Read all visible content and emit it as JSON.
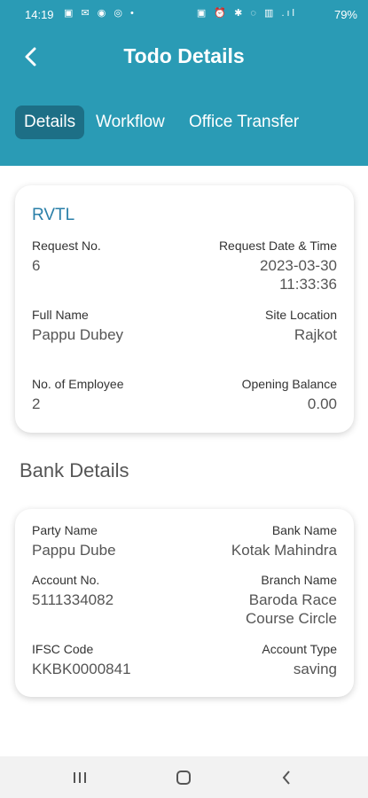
{
  "status_bar": {
    "time": "14:19",
    "left_icons": "▣ ✉ ◉ ◎ •",
    "right_icons": "▣ ⏰ ✱ ◌ ▥ .ıl",
    "battery": "79%"
  },
  "header": {
    "title": "Todo Details",
    "back_icon": "chevron-left-icon",
    "background_color": "#2a9bb5"
  },
  "tabs": [
    {
      "label": "Details",
      "active": true
    },
    {
      "label": "Workflow",
      "active": false
    },
    {
      "label": "Office Transfer",
      "active": false
    }
  ],
  "request_card": {
    "heading": "RVTL",
    "request_no_label": "Request No.",
    "request_no": "6",
    "request_date_label": "Request Date & Time",
    "request_date": "2023-03-30",
    "request_time": "11:33:36",
    "full_name_label": "Full Name",
    "full_name": "Pappu Dubey",
    "site_location_label": "Site Location",
    "site_location": "Rajkot",
    "employees_label": "No. of Employee",
    "employees": "2",
    "opening_balance_label": "Opening Balance",
    "opening_balance": "0.00"
  },
  "bank_section_title": "Bank Details",
  "bank_card": {
    "party_name_label": "Party Name",
    "party_name": "Pappu Dube",
    "bank_name_label": "Bank Name",
    "bank_name": "Kotak Mahindra",
    "account_no_label": "Account No.",
    "account_no": "5111334082",
    "branch_name_label": "Branch Name",
    "branch_line1": "Baroda Race",
    "branch_line2": "Course Circle",
    "ifsc_label": "IFSC Code",
    "ifsc": "KKBK0000841",
    "account_type_label": "Account Type",
    "account_type": "saving"
  },
  "nav_bar": {
    "recents_icon": "recents-icon",
    "home_icon": "home-icon",
    "back_icon": "back-icon"
  }
}
